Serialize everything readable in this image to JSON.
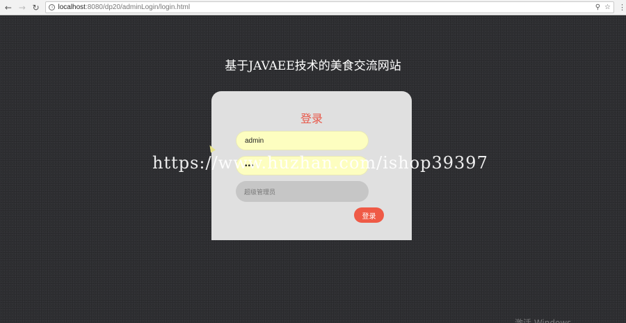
{
  "browser": {
    "back_icon": "←",
    "forward_icon": "→",
    "reload_icon": "↻",
    "url_host": "localhost",
    "url_path": ":8080/dp20/adminLogin/login.html",
    "pin_icon": "⚲",
    "star_icon": "☆",
    "menu_icon": "⋮"
  },
  "page": {
    "title": "基于JAVAEE技术的美食交流网站",
    "login": {
      "heading": "登录",
      "username_value": "admin",
      "password_value": "•••",
      "role_selected": "超级管理员",
      "submit_label": "登录"
    },
    "watermark": "https://www.huzhan.com/ishop39397",
    "os_watermark": "激活 Windows"
  }
}
